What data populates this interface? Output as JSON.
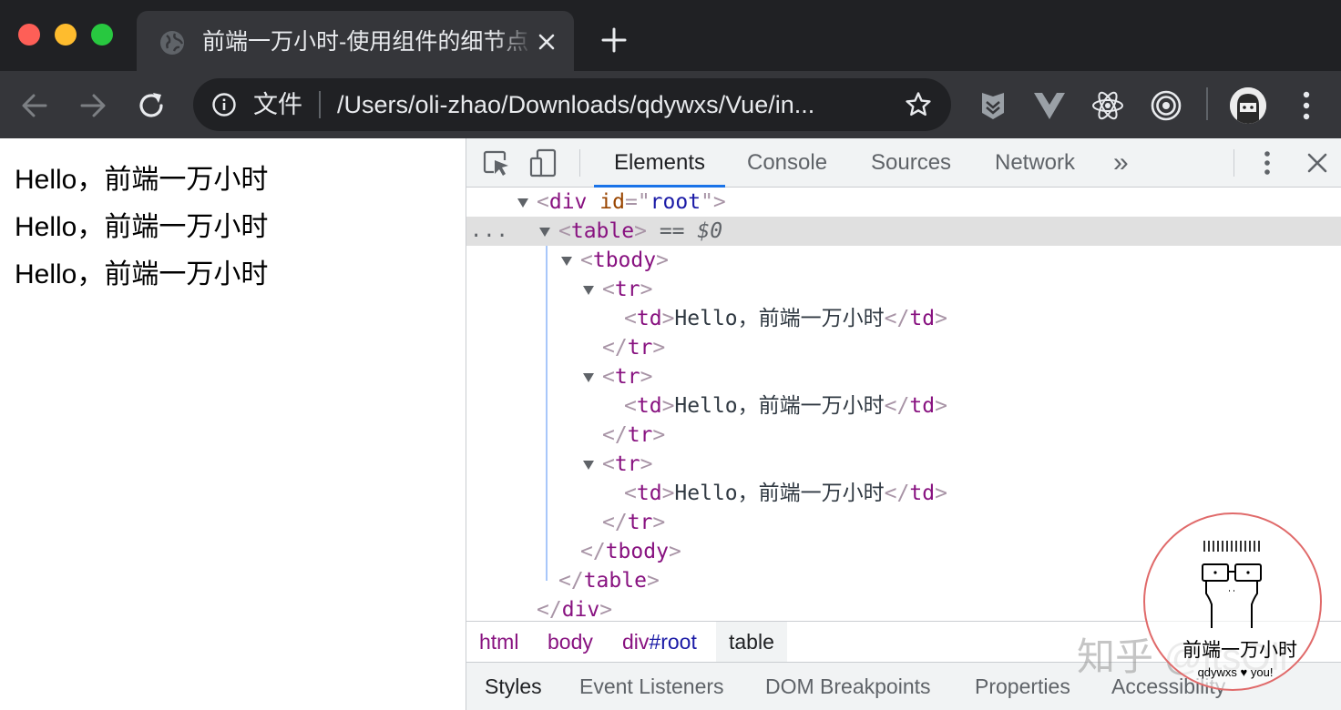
{
  "window": {
    "tab": {
      "title": "前端一万小时-使用组件的细节点",
      "favicon": "globe-icon",
      "close_icon": "close-icon"
    },
    "new_tab_icon": "plus-icon"
  },
  "toolbar": {
    "back_icon": "arrow-left-icon",
    "forward_icon": "arrow-right-icon",
    "reload_icon": "reload-icon",
    "omnibox": {
      "info_icon": "info-icon",
      "scheme_label": "文件",
      "url": "/Users/oli-zhao/Downloads/qdywxs/Vue/in...",
      "bookmark_icon": "star-icon"
    },
    "extensions": [
      "shield-extension-icon",
      "vue-devtools-icon",
      "react-devtools-icon",
      "target-extension-icon"
    ],
    "profile_icon": "avatar",
    "menu_icon": "kebab-menu-icon"
  },
  "page": {
    "lines": [
      "Hello，前端一万小时",
      "Hello，前端一万小时",
      "Hello，前端一万小时"
    ]
  },
  "devtools": {
    "tabs": [
      {
        "label": "Elements",
        "active": true
      },
      {
        "label": "Console",
        "active": false
      },
      {
        "label": "Sources",
        "active": false
      },
      {
        "label": "Network",
        "active": false
      }
    ],
    "more_tabs_label": "»",
    "dom": {
      "root_tag": "div",
      "root_attr": "id",
      "root_id": "root",
      "table_tag": "table",
      "selected_marker": "==",
      "selected_var": "$0",
      "tbody_tag": "tbody",
      "tr_tag": "tr",
      "td_tag": "td",
      "cell_text": "Hello，前端一万小时",
      "ellipsis": "..."
    },
    "breadcrumbs": {
      "html": "html",
      "body": "body",
      "div_tag": "div",
      "div_id": "#root",
      "table": "table"
    },
    "subtabs": [
      "Styles",
      "Event Listeners",
      "DOM Breakpoints",
      "Properties",
      "Accessibility"
    ]
  },
  "watermark": {
    "brand": "前端一万小时",
    "sub": "qdywxs ♥ you!",
    "site": "知乎 @itsOli"
  }
}
